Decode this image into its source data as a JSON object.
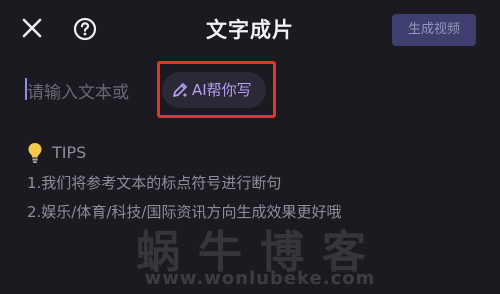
{
  "header": {
    "title": "文字成片",
    "generate_button": "生成视频",
    "close_icon": "close-icon",
    "help_icon": "help-circle-icon"
  },
  "input": {
    "placeholder": "请输入文本或",
    "ai_button_label": "AI帮你写",
    "ai_icon": "pen-sparkle-icon"
  },
  "tips": {
    "icon": "lightbulb-icon",
    "title": "TIPS",
    "items": [
      "1.我们将参考文本的标点符号进行断句",
      "2.娱乐/体育/科技/国际资讯方向生成效果更好哦"
    ]
  },
  "watermark": {
    "title": "蜗牛博客",
    "url": "www.wonlubeke.com"
  },
  "colors": {
    "background": "#1b1a21",
    "accent": "#b79ef7",
    "highlight_border": "#e5371f",
    "generate_button_bg": "#3e3f6e"
  }
}
